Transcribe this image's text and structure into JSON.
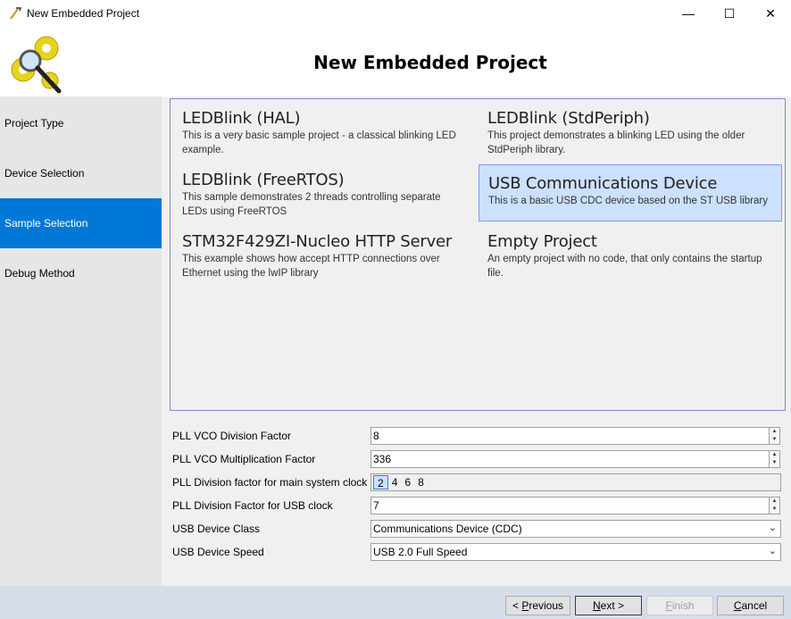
{
  "window": {
    "title": "New Embedded Project",
    "controls": {
      "minimize": "—",
      "maximize": "☐",
      "close": "✕"
    }
  },
  "header": {
    "heading": "New Embedded Project",
    "logo_icon": "gears-magnifier-icon"
  },
  "sidebar": {
    "items": [
      {
        "label": "Project Type",
        "active": false
      },
      {
        "label": "Device Selection",
        "active": false
      },
      {
        "label": "Sample Selection",
        "active": true
      },
      {
        "label": "Debug Method",
        "active": false
      }
    ]
  },
  "samples": [
    {
      "title": "LEDBlink (HAL)",
      "description": "This is a very basic sample project - a classical blinking LED example."
    },
    {
      "title": "LEDBlink (StdPeriph)",
      "description": "This project demonstrates a blinking LED using the older StdPeriph library."
    },
    {
      "title": "LEDBlink (FreeRTOS)",
      "description": "This sample demonstrates 2 threads controlling separate LEDs using FreeRTOS"
    },
    {
      "title": "USB Communications Device",
      "description": "This is a basic USB CDC device based on the ST USB library",
      "selected": true
    },
    {
      "title": "STM32F429ZI-Nucleo HTTP Server",
      "description": "This example shows how accept HTTP connections over Ethernet using the lwIP library"
    },
    {
      "title": "Empty Project",
      "description": "An empty project with no code, that only contains the startup file."
    }
  ],
  "properties": {
    "pll_vco_div": {
      "label": "PLL VCO Division Factor",
      "value": "8"
    },
    "pll_vco_mul": {
      "label": "PLL VCO Multiplication Factor",
      "value": "336"
    },
    "pll_main_div": {
      "label": "PLL Division factor for main system clock",
      "options": [
        "2",
        "4",
        "6",
        "8"
      ],
      "selected": "2"
    },
    "pll_usb_div": {
      "label": "PLL Division Factor for USB clock",
      "value": "7"
    },
    "usb_class": {
      "label": "USB Device Class",
      "value": "Communications Device (CDC)"
    },
    "usb_speed": {
      "label": "USB Device Speed",
      "value": "USB 2.0 Full Speed"
    }
  },
  "footer": {
    "previous": {
      "prefix": "< ",
      "accel": "P",
      "rest": "revious"
    },
    "next": {
      "accel": "N",
      "rest": "ext >"
    },
    "finish": {
      "accel": "F",
      "rest": "inish"
    },
    "cancel": {
      "accel": "C",
      "rest": "ancel"
    }
  },
  "colors": {
    "accent": "#0078d7",
    "selection_bg": "#cce0ff",
    "footer_bg": "#d6deeb"
  }
}
